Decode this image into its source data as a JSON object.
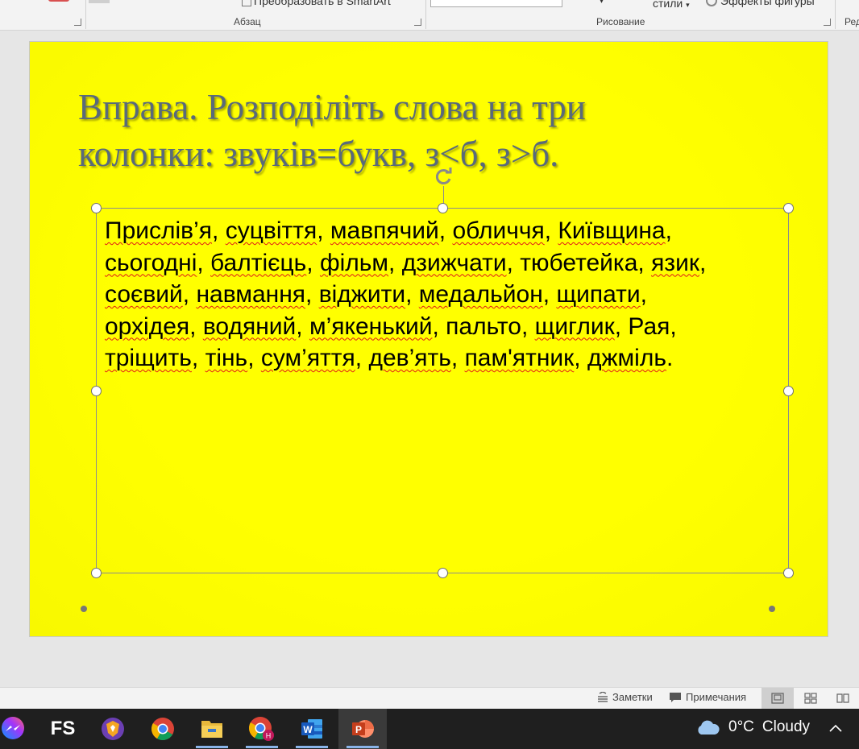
{
  "ribbon": {
    "smartart_label": "Преобразовать в SmartArt",
    "styles_label": "стили",
    "shape_effects_label": "Эффекты фигуры",
    "groups": {
      "paragraph": "Абзац",
      "drawing": "Рисование",
      "editing": "Ред"
    }
  },
  "slide": {
    "title": "Вправа. Розподіліть слова на три колонки: звуків=букв, з<б, з>б.",
    "content": [
      [
        {
          "t": "Прислів’я",
          "s": true
        },
        {
          "t": ", "
        },
        {
          "t": "суцвіття",
          "s": true
        },
        {
          "t": ", "
        },
        {
          "t": "мавпячий",
          "s": true
        },
        {
          "t": ", "
        },
        {
          "t": "обличчя",
          "s": true
        },
        {
          "t": ", "
        },
        {
          "t": "Київщина",
          "s": true
        },
        {
          "t": ","
        }
      ],
      [
        {
          "t": "сьогодні",
          "s": true
        },
        {
          "t": ", "
        },
        {
          "t": "балтієць",
          "s": true
        },
        {
          "t": ", "
        },
        {
          "t": "фільм",
          "s": true
        },
        {
          "t": ", "
        },
        {
          "t": "дзижчати",
          "s": true
        },
        {
          "t": ", тюбетейка, "
        },
        {
          "t": "язик",
          "s": true
        },
        {
          "t": ","
        }
      ],
      [
        {
          "t": "соєвий",
          "s": true
        },
        {
          "t": ", "
        },
        {
          "t": "навмання",
          "s": true
        },
        {
          "t": ", "
        },
        {
          "t": "віджити",
          "s": true
        },
        {
          "t": ", "
        },
        {
          "t": "медальйон",
          "s": true
        },
        {
          "t": ", "
        },
        {
          "t": "щипати",
          "s": true
        },
        {
          "t": ","
        }
      ],
      [
        {
          "t": "орхідея",
          "s": true
        },
        {
          "t": ", "
        },
        {
          "t": "водяний",
          "s": true
        },
        {
          "t": ", "
        },
        {
          "t": "м’якенький",
          "s": true
        },
        {
          "t": ", пальто, "
        },
        {
          "t": "щиглик",
          "s": true
        },
        {
          "t": ", Рая,"
        }
      ],
      [
        {
          "t": "тріщить",
          "s": true
        },
        {
          "t": ", "
        },
        {
          "t": "тінь",
          "s": true
        },
        {
          "t": ", "
        },
        {
          "t": "сум’яття",
          "s": true
        },
        {
          "t": ", "
        },
        {
          "t": "дев’ять",
          "s": true
        },
        {
          "t": ", "
        },
        {
          "t": "пам'ятник",
          "s": true
        },
        {
          "t": ", "
        },
        {
          "t": "джміль",
          "s": true
        },
        {
          "t": "."
        }
      ]
    ]
  },
  "statusbar": {
    "notes_label": "Заметки",
    "comments_label": "Примечания"
  },
  "taskbar": {
    "apps": [
      "messenger-icon",
      "fs-icon",
      "brave-icon",
      "chrome-icon",
      "file-explorer-icon",
      "chrome-profile-icon",
      "word-icon",
      "powerpoint-icon"
    ],
    "fs_label": "FS",
    "weather": {
      "temp": "0°C",
      "condition": "Cloudy"
    }
  },
  "colors": {
    "slide_background": "#ffff00",
    "title_color": "#596a7b",
    "spellcheck_underline": "#e01818"
  }
}
